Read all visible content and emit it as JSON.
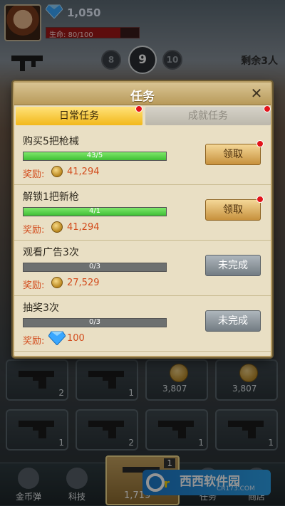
{
  "hud": {
    "gems": "1,050",
    "hp_text": "生命: 80/100",
    "hp_fraction": 0.8,
    "remaining": "剩余3人"
  },
  "levels": [
    "8",
    "9",
    "10"
  ],
  "modal": {
    "title": "任务",
    "close": "✕",
    "tabs": [
      {
        "label": "日常任务",
        "active": true,
        "dot": true
      },
      {
        "label": "成就任务",
        "active": false,
        "dot": true
      }
    ],
    "tasks": [
      {
        "name": "购买5把枪械",
        "progress_text": "43/5",
        "progress": 1.0,
        "reward_label": "奖励:",
        "reward_type": "coin",
        "reward": "41,294",
        "button": "领取",
        "state": "claim",
        "dot": true
      },
      {
        "name": "解锁1把新枪",
        "progress_text": "4/1",
        "progress": 1.0,
        "reward_label": "奖励:",
        "reward_type": "coin",
        "reward": "41,294",
        "button": "领取",
        "state": "claim",
        "dot": true
      },
      {
        "name": "观看广告3次",
        "progress_text": "0/3",
        "progress": 0.0,
        "reward_label": "奖励:",
        "reward_type": "coin",
        "reward": "27,529",
        "button": "未完成",
        "state": "pending",
        "dot": false
      },
      {
        "name": "抽奖3次",
        "progress_text": "0/3",
        "progress": 0.0,
        "reward_label": "奖励:",
        "reward_type": "gem",
        "reward": "100",
        "button": "未完成",
        "state": "pending",
        "dot": false
      }
    ]
  },
  "grid": {
    "row1": [
      {
        "type": "gun",
        "count": "2"
      },
      {
        "type": "gun",
        "count": "1"
      },
      {
        "type": "coin",
        "price": "3,807"
      },
      {
        "type": "coin",
        "price": "3,807"
      }
    ],
    "row2": [
      {
        "type": "gun",
        "count": "1"
      },
      {
        "type": "gun",
        "count": "2"
      },
      {
        "type": "gun",
        "count": "1"
      },
      {
        "type": "gun",
        "count": "1"
      }
    ]
  },
  "nav": {
    "left1": "金币弹",
    "left2": "科技",
    "center_badge": "1",
    "center_amount": "1,719",
    "right1": "任务",
    "right2": "商店"
  },
  "watermark": {
    "big": "西西软件园",
    "small": "CR173.COM"
  },
  "colors": {
    "accent_gold": "#f2b81a",
    "progress_green": "#3fbe35",
    "reward_red": "#d24b1c",
    "notify_red": "#e2141b"
  }
}
